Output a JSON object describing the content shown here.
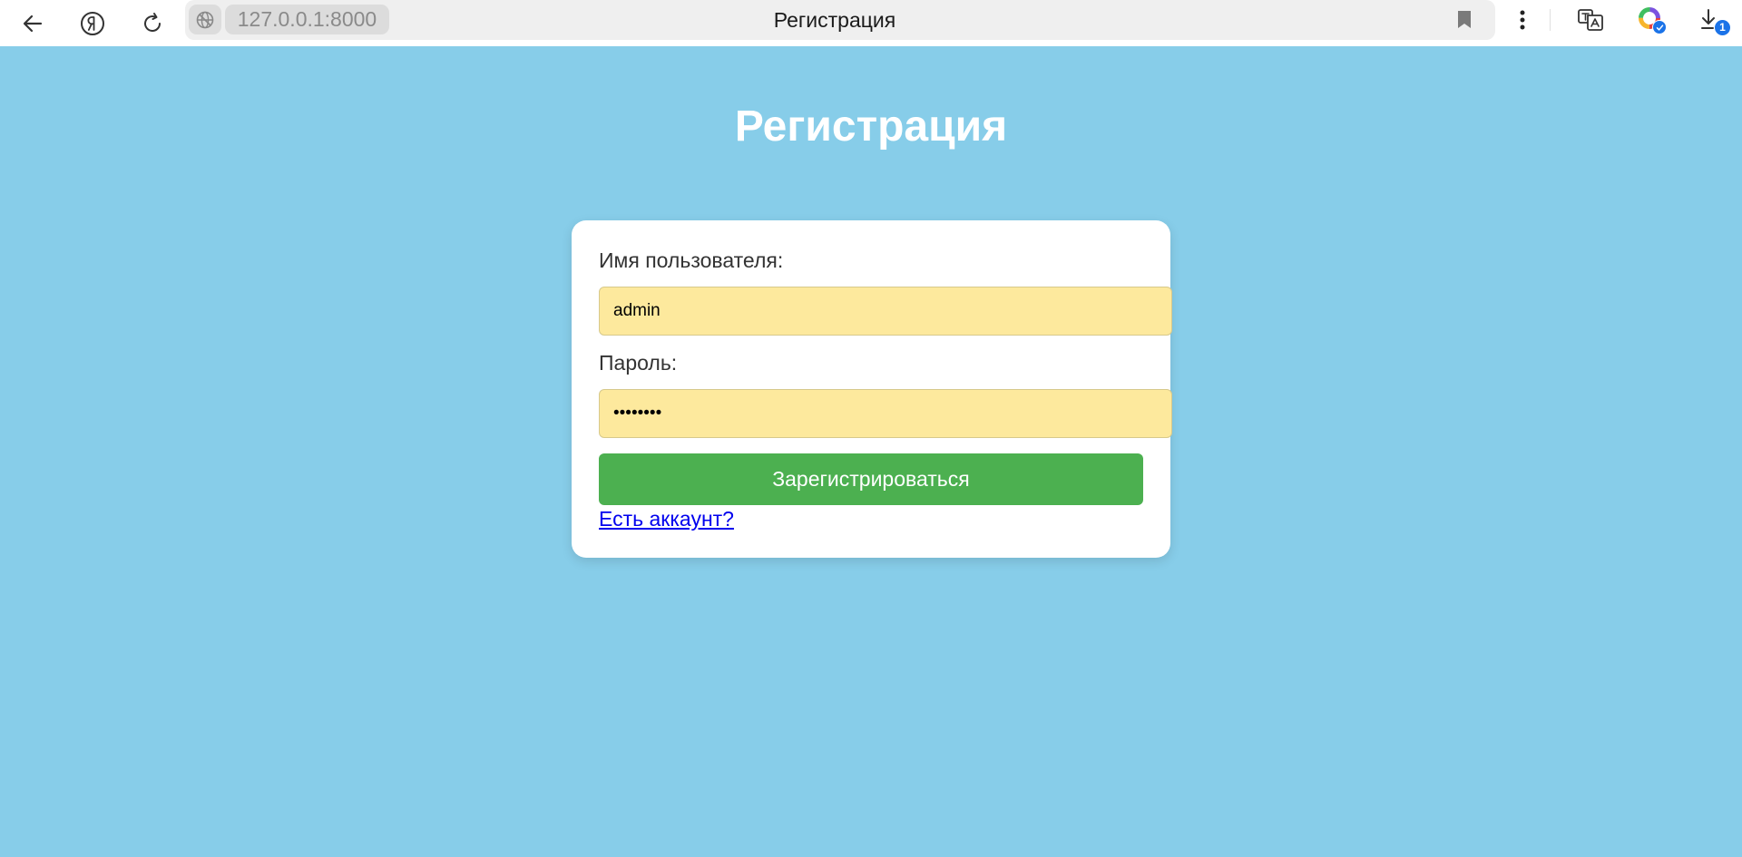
{
  "browser": {
    "url": "127.0.0.1:8000",
    "tab_title": "Регистрация",
    "download_count": "1",
    "icons": {
      "back": "back-arrow-icon",
      "home": "yandex-logo-icon",
      "reload": "reload-icon",
      "site": "globe-icon",
      "bookmark": "bookmark-icon",
      "menu": "kebab-menu-icon",
      "translate": "translate-icon",
      "extension": "color-wheel-icon",
      "downloads": "download-icon"
    }
  },
  "page": {
    "heading": "Регистрация",
    "username_label": "Имя пользователя:",
    "username_value": "admin",
    "password_label": "Пароль:",
    "password_value": "••••••••",
    "submit_label": "Зарегистрироваться",
    "login_link": "Есть аккаунт?"
  },
  "colors": {
    "background": "#87CDE9",
    "input_fill": "#FDE99D",
    "button": "#4CB050",
    "link": "#0000EE"
  }
}
